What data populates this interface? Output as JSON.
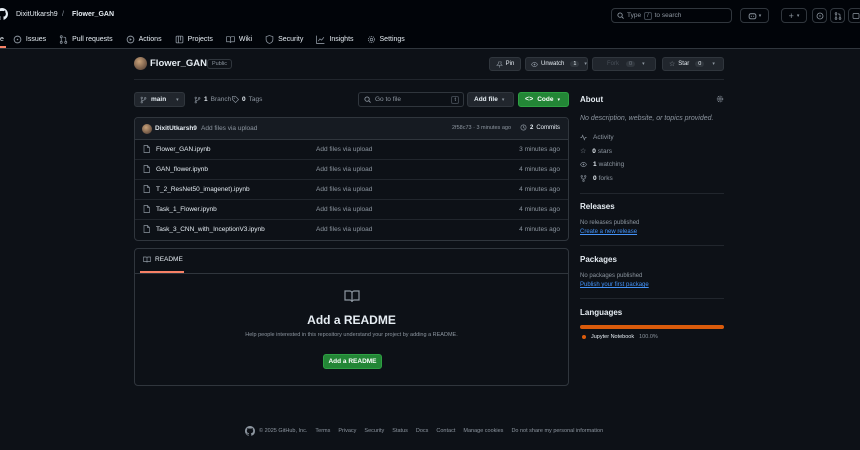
{
  "header": {
    "owner": "DixitUtkarsh9",
    "separator": "/",
    "repo": "Flower_GAN",
    "search_placeholder_pre": "Type",
    "search_key": "/",
    "search_placeholder_post": "to search",
    "plus_label": "+"
  },
  "tabs": [
    {
      "label": "Issues",
      "icon": "issue-icon"
    },
    {
      "label": "Pull requests",
      "icon": "pull-request-icon"
    },
    {
      "label": "Actions",
      "icon": "actions-icon"
    },
    {
      "label": "Projects",
      "icon": "projects-icon"
    },
    {
      "label": "Wiki",
      "icon": "wiki-icon"
    },
    {
      "label": "Security",
      "icon": "shield-icon"
    },
    {
      "label": "Insights",
      "icon": "graph-icon"
    },
    {
      "label": "Settings",
      "icon": "gear-icon"
    }
  ],
  "repo": {
    "name": "Flower_GAN",
    "visibility": "Public",
    "pin": "Pin",
    "unwatch": "Unwatch",
    "watch_count": "1",
    "fork": "Fork",
    "fork_count": "0",
    "star": "Star",
    "star_count": "0"
  },
  "toolbar": {
    "branch": "main",
    "branches_count": "1",
    "branches_label": "Branch",
    "tags_count": "0",
    "tags_label": "Tags",
    "goto_placeholder": "Go to file",
    "goto_key": "t",
    "add_file": "Add file",
    "code": "Code"
  },
  "commit": {
    "author": "DixitUtkarsh9",
    "message": "Add files via upload",
    "hash_time": "2f58c73 · 3 minutes ago",
    "commits_count": "2",
    "commits_label": "Commits"
  },
  "files": [
    {
      "name": "Flower_GAN.ipynb",
      "message": "Add files via upload",
      "time": "3 minutes ago"
    },
    {
      "name": "GAN_flower.ipynb",
      "message": "Add files via upload",
      "time": "4 minutes ago"
    },
    {
      "name": "T_2_ResNet50_imagenet).ipynb",
      "message": "Add files via upload",
      "time": "4 minutes ago"
    },
    {
      "name": "Task_1_Flower.ipynb",
      "message": "Add files via upload",
      "time": "4 minutes ago"
    },
    {
      "name": "Task_3_CNN_with_InceptionV3.ipynb",
      "message": "Add files via upload",
      "time": "4 minutes ago"
    }
  ],
  "readme": {
    "tab": "README",
    "title": "Add a README",
    "description": "Help people interested in this repository understand your project by adding a README.",
    "button": "Add a README"
  },
  "sidebar": {
    "about_title": "About",
    "about_text": "No description, website, or topics provided.",
    "activity": "Activity",
    "stars_count": "0",
    "stars_label": "stars",
    "watching_count": "1",
    "watching_label": "watching",
    "forks_count": "0",
    "forks_label": "forks",
    "releases_title": "Releases",
    "releases_text": "No releases published",
    "releases_link": "Create a new release",
    "packages_title": "Packages",
    "packages_text": "No packages published",
    "packages_link": "Publish your first package",
    "languages_title": "Languages",
    "language_name": "Jupyter Notebook",
    "language_pct": "100.0%",
    "language_color": "#DA5B0B"
  },
  "footer": {
    "copyright": "© 2025 GitHub, Inc.",
    "links": [
      "Terms",
      "Privacy",
      "Security",
      "Status",
      "Docs",
      "Contact",
      "Manage cookies",
      "Do not share my personal information"
    ]
  },
  "colors": {
    "accent_green": "#238636",
    "link_blue": "#4493f8",
    "underline_orange": "#f78166"
  }
}
